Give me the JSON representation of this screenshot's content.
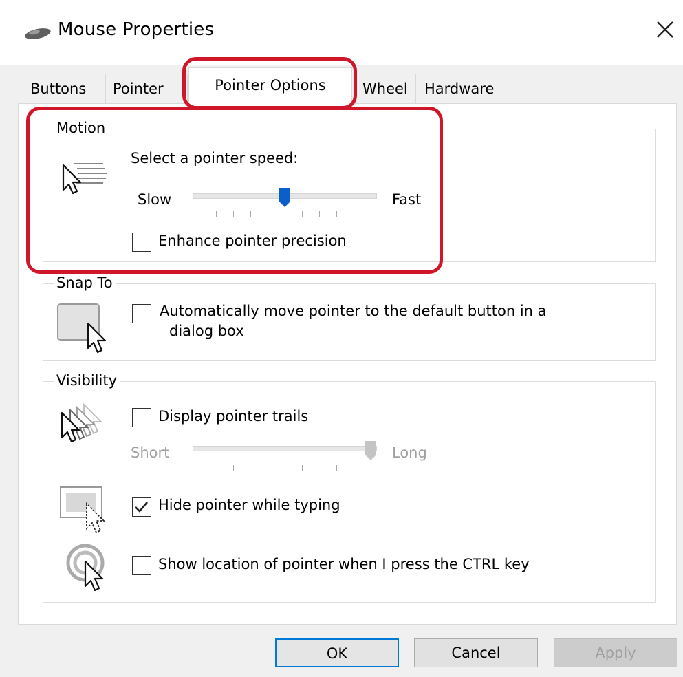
{
  "window": {
    "title": "Mouse Properties",
    "icon": "mouse-icon",
    "close_icon": "close-icon"
  },
  "tabs": [
    {
      "label": "Buttons"
    },
    {
      "label": "Pointer"
    },
    {
      "label": "Pointer Options",
      "active": true
    },
    {
      "label": "Wheel"
    },
    {
      "label": "Hardware"
    }
  ],
  "motion": {
    "group_title": "Motion",
    "prompt": "Select a pointer speed:",
    "slow_label": "Slow",
    "fast_label": "Fast",
    "speed_position": 0.5,
    "enhance_label": "Enhance pointer precision",
    "enhance_checked": false
  },
  "snap_to": {
    "group_title": "Snap To",
    "auto_move_label": "Automatically move pointer to the default button in a",
    "auto_move_label_line2": "dialog box",
    "auto_move_checked": false
  },
  "visibility": {
    "group_title": "Visibility",
    "trails_label": "Display pointer trails",
    "trails_checked": false,
    "short_label": "Short",
    "long_label": "Long",
    "trail_length_position": 1.0,
    "hide_typing_label": "Hide pointer while typing",
    "hide_typing_checked": true,
    "show_location_label": "Show location of pointer when I press the CTRL key",
    "show_location_checked": false
  },
  "buttons": {
    "ok": "OK",
    "cancel": "Cancel",
    "apply": "Apply"
  },
  "colors": {
    "highlight": "#d0172a",
    "accent": "#0078d7",
    "slider_thumb": "#0a5fc9"
  }
}
